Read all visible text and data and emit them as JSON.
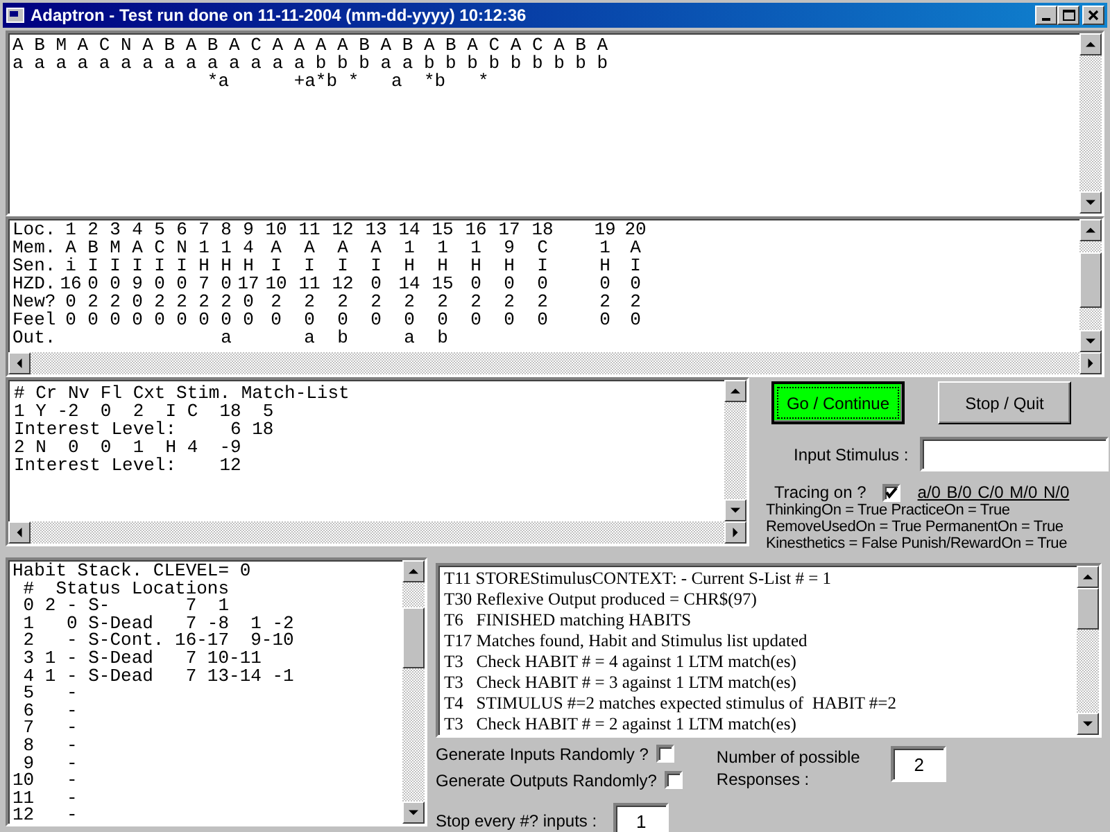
{
  "window": {
    "title": "Adaptron - Test run done on 11-11-2004 (mm-dd-yyyy) 10:12:36"
  },
  "stimulus_trace": {
    "lines": [
      "A B M A C N A B A B A C A A A A B A B A B A C A C A B A",
      "a a a a a a a a a a a a a a b b b a a b b b b b b b b b",
      "                  *a      +a*b *   a  *b   *"
    ]
  },
  "memory_table": {
    "rows": [
      {
        "label": "Loc.",
        "cells": [
          "1",
          "2",
          "3",
          "4",
          "5",
          "6",
          "7",
          "8",
          "9",
          "10",
          "11",
          "12",
          "13",
          "14",
          "15",
          "16",
          "17",
          "18",
          "19",
          "20"
        ]
      },
      {
        "label": "Mem.",
        "cells": [
          "A",
          "B",
          "M",
          "A",
          "C",
          "N",
          "1",
          "1",
          "4",
          "A",
          "A",
          "A",
          "A",
          "1",
          "1",
          "1",
          "9",
          "C",
          "1",
          "A"
        ]
      },
      {
        "label": "Sen.",
        "cells": [
          "i",
          "I",
          "I",
          "I",
          "I",
          "I",
          "H",
          "H",
          "H",
          "I",
          "I",
          "I",
          "I",
          "H",
          "H",
          "H",
          "H",
          "I",
          "H",
          "I"
        ]
      },
      {
        "label": "HZD.",
        "cells": [
          "16",
          "0",
          "0",
          "9",
          "0",
          "0",
          "7",
          "0",
          "17",
          "10",
          "11",
          "12",
          "0",
          "14",
          "15",
          "0",
          "0",
          "0",
          "0",
          "0"
        ]
      },
      {
        "label": "New?",
        "cells": [
          "0",
          "2",
          "2",
          "0",
          "2",
          "2",
          "2",
          "2",
          "0",
          "2",
          "2",
          "2",
          "2",
          "2",
          "2",
          "2",
          "2",
          "2",
          "2",
          "2"
        ]
      },
      {
        "label": "Feel",
        "cells": [
          "0",
          "0",
          "0",
          "0",
          "0",
          "0",
          "0",
          "0",
          "0",
          "0",
          "0",
          "0",
          "0",
          "0",
          "0",
          "0",
          "0",
          "0",
          "0",
          "0"
        ]
      },
      {
        "label": "Out.",
        "cells": [
          null,
          null,
          null,
          null,
          null,
          null,
          null,
          "a",
          null,
          null,
          "a",
          "b",
          null,
          "a",
          "b",
          null,
          null,
          null,
          null,
          null
        ]
      }
    ]
  },
  "match_list": {
    "lines": [
      "# Cr Nv Fl Cxt Stim. Match-List",
      "1 Y -2  0  2  I C  18  5",
      "Interest Level:     6 18",
      "2 N  0  0  1  H 4  -9",
      "Interest Level:    12"
    ]
  },
  "buttons": [
    {
      "label": "Go / Continue",
      "kind": "primary"
    },
    {
      "label": "Stop / Quit",
      "kind": "normal"
    }
  ],
  "input_stimulus": {
    "label": "Input Stimulus :"
  },
  "tracing": {
    "label": "Tracing on ?",
    "checked": true,
    "codes": "a/0  B/0  C/0  M/0  N/0"
  },
  "settings": [
    "ThinkingOn = True PracticeOn = True",
    "RemoveUsedOn = True PermanentOn = True",
    "Kinesthetics = False Punish/RewardOn = True"
  ],
  "habit_stack": {
    "lines": [
      "Habit Stack. CLEVEL= 0",
      " #  Status Locations",
      " 0 2 - S-       7  1",
      " 1   0 S-Dead   7 -8  1 -2",
      " 2   - S-Cont. 16-17  9-10",
      " 3 1 - S-Dead   7 10-11",
      " 4 1 - S-Dead   7 13-14 -1",
      " 5   -",
      " 6   -",
      " 7   -",
      " 8   -",
      " 9   -",
      "10   -",
      "11   -",
      "12   -"
    ]
  },
  "trace_log": {
    "lines": [
      "T11 STOREStimulusCONTEXT: - Current S-List # = 1",
      "T30 Reflexive Output produced = CHR$(97)",
      "T6   FINISHED matching HABITS",
      "T17 Matches found, Habit and Stimulus list updated",
      "T3   Check HABIT # = 4 against 1 LTM match(es)",
      "T3   Check HABIT # = 3 against 1 LTM match(es)",
      "T4   STIMULUS #=2 matches expected stimulus of  HABIT #=2",
      "T3   Check HABIT # = 2 against 1 LTM match(es)"
    ]
  },
  "generate_inputs": {
    "label": "Generate Inputs Randomly ?",
    "checked": false
  },
  "generate_outputs": {
    "label": "Generate Outputs Randomly?",
    "checked": false
  },
  "possible_responses": {
    "label": "Number of possible Responses :",
    "value": "2"
  },
  "stop_every": {
    "label": "Stop every #? inputs :",
    "value": "1"
  }
}
